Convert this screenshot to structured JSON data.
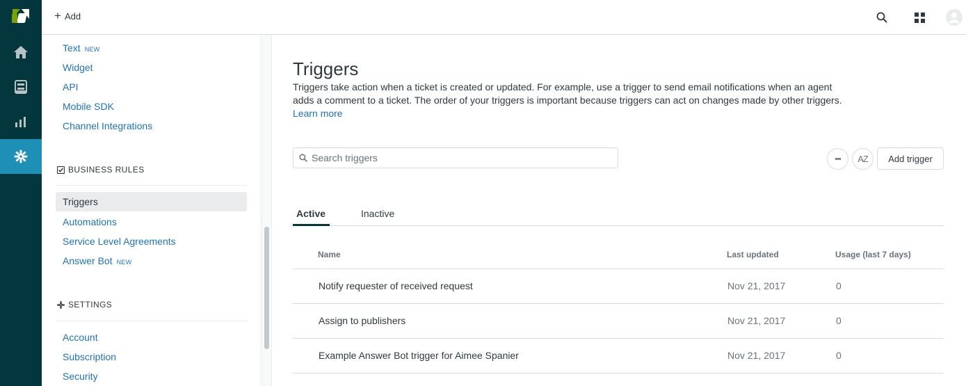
{
  "topbar": {
    "add_label": "Add",
    "icons": [
      "search-icon",
      "apps-grid-icon",
      "user-avatar-icon"
    ]
  },
  "rail": {
    "items": [
      "home-icon",
      "views-icon",
      "reporting-icon",
      "admin-gear-icon"
    ],
    "active": "admin-gear-icon",
    "brand_color": "#03363d",
    "active_color": "#1e8fb5"
  },
  "sidebar": {
    "channels": [
      {
        "label": "Text",
        "badge": "NEW"
      },
      {
        "label": "Widget"
      },
      {
        "label": "API"
      },
      {
        "label": "Mobile SDK"
      },
      {
        "label": "Channel Integrations"
      }
    ],
    "business_rules": {
      "heading": "BUSINESS RULES",
      "items": [
        {
          "label": "Triggers"
        },
        {
          "label": "Automations"
        },
        {
          "label": "Service Level Agreements"
        },
        {
          "label": "Answer Bot",
          "badge": "NEW"
        }
      ]
    },
    "settings": {
      "heading": "SETTINGS",
      "items": [
        {
          "label": "Account"
        },
        {
          "label": "Subscription"
        },
        {
          "label": "Security"
        }
      ]
    }
  },
  "main": {
    "title": "Triggers",
    "description": "Triggers take action when a ticket is created or updated. For example, use a trigger to send email notifications when an agent adds a comment to a ticket. The order of your triggers is important because triggers can act on changes made by other triggers.",
    "learn_more": "Learn more",
    "search_placeholder": "Search triggers",
    "more_label": "•••",
    "sort_label": "AZ",
    "add_trigger_label": "Add trigger",
    "tabs": [
      {
        "label": "Active"
      },
      {
        "label": "Inactive"
      }
    ],
    "columns": {
      "name": "Name",
      "last_updated": "Last updated",
      "usage": "Usage (last 7 days)"
    },
    "rows": [
      {
        "name": "Notify requester of received request",
        "last_updated": "Nov 21, 2017",
        "usage": "0"
      },
      {
        "name": "Assign to publishers",
        "last_updated": "Nov 21, 2017",
        "usage": "0"
      },
      {
        "name": "Example Answer Bot trigger for Aimee Spanier",
        "last_updated": "Nov 21, 2017",
        "usage": "0"
      }
    ]
  }
}
